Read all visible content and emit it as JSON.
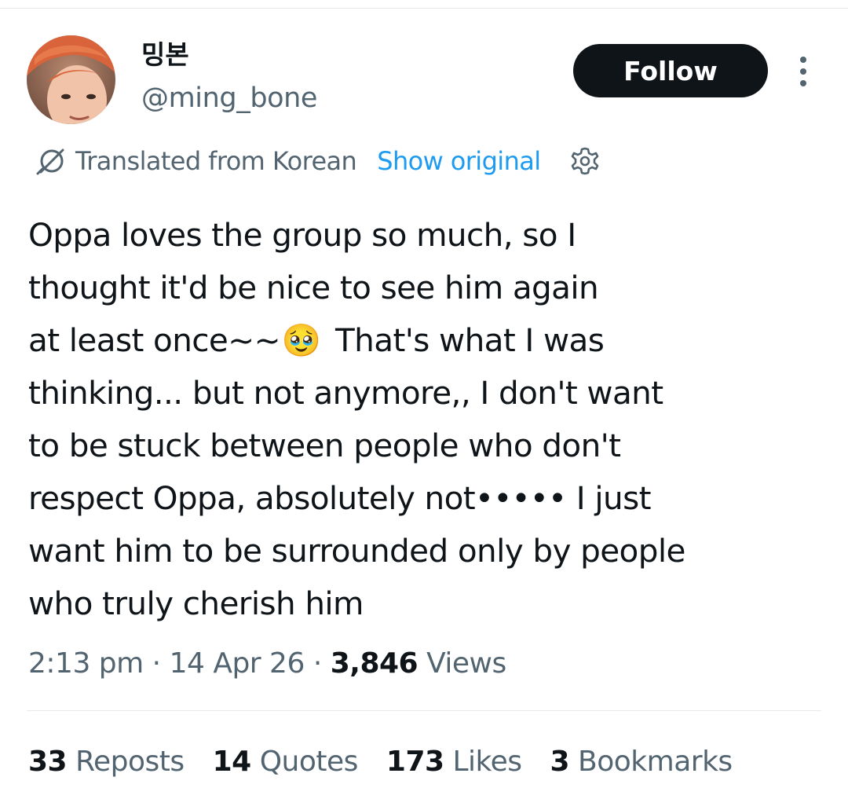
{
  "user": {
    "display_name": "밍본",
    "handle": "@ming_bone"
  },
  "follow_label": "Follow",
  "translation": {
    "label": "Translated from Korean",
    "show_original": "Show original"
  },
  "tweet": {
    "lines": [
      "Oppa loves the group so much, so I",
      "thought it'd be nice to see him again",
      "at least once~~",
      "That's what I was",
      "thinking... but not anymore,, I don't want",
      "to be stuck between people who don't",
      "respect Oppa, absolutely not••••• I just",
      "want him to be surrounded only by people",
      "who truly cherish him"
    ],
    "emoji": "🥹"
  },
  "meta": {
    "time": "2:13 pm",
    "date": "14 Apr 26",
    "separator": "·",
    "views_count": "3,846",
    "views_label": "Views"
  },
  "stats": [
    {
      "count": "33",
      "label": "Reposts"
    },
    {
      "count": "14",
      "label": "Quotes"
    },
    {
      "count": "173",
      "label": "Likes"
    },
    {
      "count": "3",
      "label": "Bookmarks"
    }
  ],
  "colors": {
    "text_primary": "#0f1419",
    "text_secondary": "#536471",
    "link": "#1d9bf0",
    "button_bg": "#0f1419",
    "divider": "#e6e9eb"
  },
  "icons": {
    "avatar": "profile-photo-avatar",
    "more": "more-vertical-icon",
    "translate": "translate-slash-icon",
    "settings": "gear-icon"
  }
}
